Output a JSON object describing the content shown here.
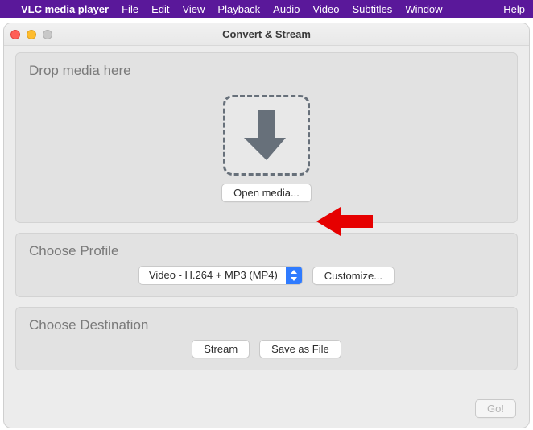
{
  "menubar": {
    "app_name": "VLC media player",
    "items": [
      "File",
      "Edit",
      "View",
      "Playback",
      "Audio",
      "Video",
      "Subtitles",
      "Window",
      "Help"
    ]
  },
  "window": {
    "title": "Convert & Stream"
  },
  "drop": {
    "title": "Drop media here",
    "open_label": "Open media..."
  },
  "profile": {
    "title": "Choose Profile",
    "selected": "Video - H.264 + MP3 (MP4)",
    "customize_label": "Customize..."
  },
  "destination": {
    "title": "Choose Destination",
    "stream_label": "Stream",
    "save_label": "Save as File"
  },
  "footer": {
    "go_label": "Go!"
  }
}
